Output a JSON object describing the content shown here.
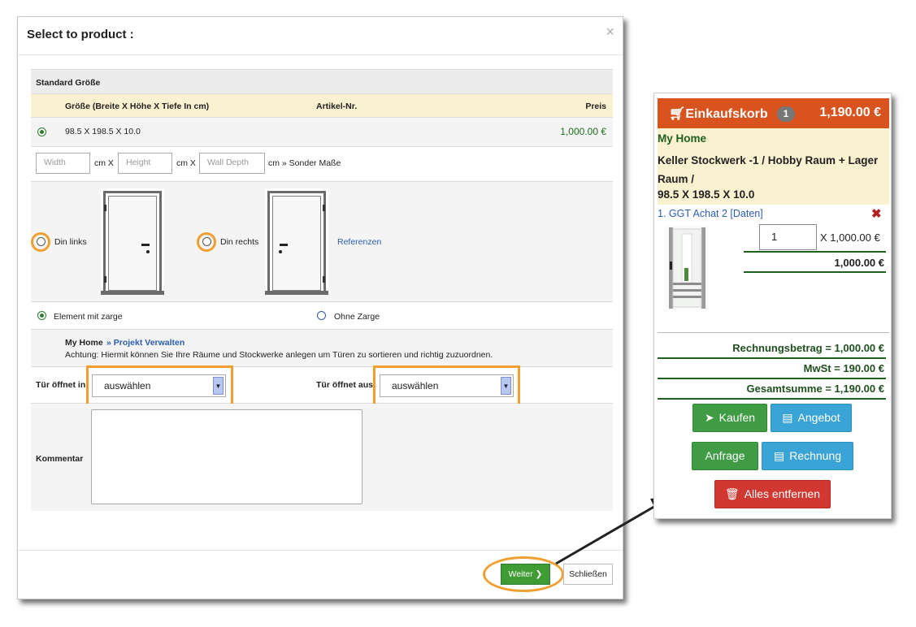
{
  "modal": {
    "title": "Select to product :",
    "close_glyph": "×",
    "standard_label": "Standard Größe",
    "columns": {
      "size": "Größe (Breite X Höhe X Tiefe In cm)",
      "article": "Artikel-Nr.",
      "price": "Preis"
    },
    "size_row": {
      "value": "98.5 X 198.5 X 10.0",
      "price": "1,000.00 €"
    },
    "custom": {
      "width_placeholder": "Width",
      "height_placeholder": "Height",
      "depth_placeholder": "Wall Depth",
      "unit_x1": "cm X",
      "unit_x2": "cm X",
      "unit_end": "cm » Sonder Maße"
    },
    "din": {
      "left_label": "Din links",
      "right_label": "Din rechts",
      "references_link": "Referenzen"
    },
    "zarge": {
      "with_label": "Element mit zarge",
      "without_label": "Ohne Zarge"
    },
    "project": {
      "home": "My Home",
      "manage_link": "» Projekt Verwalten",
      "note": "Achtung: Hiermit können Sie Ihre Räume und Stockwerke anlegen um Türen zu sortieren und richtig zuzuordnen."
    },
    "door_in": {
      "label": "Tür öffnet in",
      "value": "auswählen"
    },
    "door_out": {
      "label": "Tür öffnet aus",
      "value": "auswählen"
    },
    "comment_label": "Kommentar",
    "next_button": "Weiter",
    "close_button": "Schließen"
  },
  "cart": {
    "title": "Einkaufskorb",
    "count": "1",
    "total_head": "1,190.00 €",
    "home": "My Home",
    "room": "Keller Stockwerk -1 / Hobby Raum + Lager Raum /",
    "dimensions": "98.5 X 198.5 X 10.0",
    "item": {
      "name": "1. GGT Achat 2 [Daten]",
      "qty": "1",
      "unit_price": "X 1,000.00 €",
      "row_total": "1,000.00 €"
    },
    "invoice": "Rechnungsbetrag = 1,000.00 €",
    "vat": "MwSt = 190.00 €",
    "grand_total": "Gesamtsumme = 1,190.00 €",
    "buttons": {
      "buy": "Kaufen",
      "offer": "Angebot",
      "inquiry": "Anfrage",
      "invoice": "Rechnung",
      "remove_all": "Alles entfernen"
    }
  },
  "colors": {
    "highlight": "#f0a030",
    "cart_header": "#d9531e",
    "success_green": "#3f9c44",
    "info_blue": "#3ba4d6",
    "danger_red": "#d23832"
  }
}
